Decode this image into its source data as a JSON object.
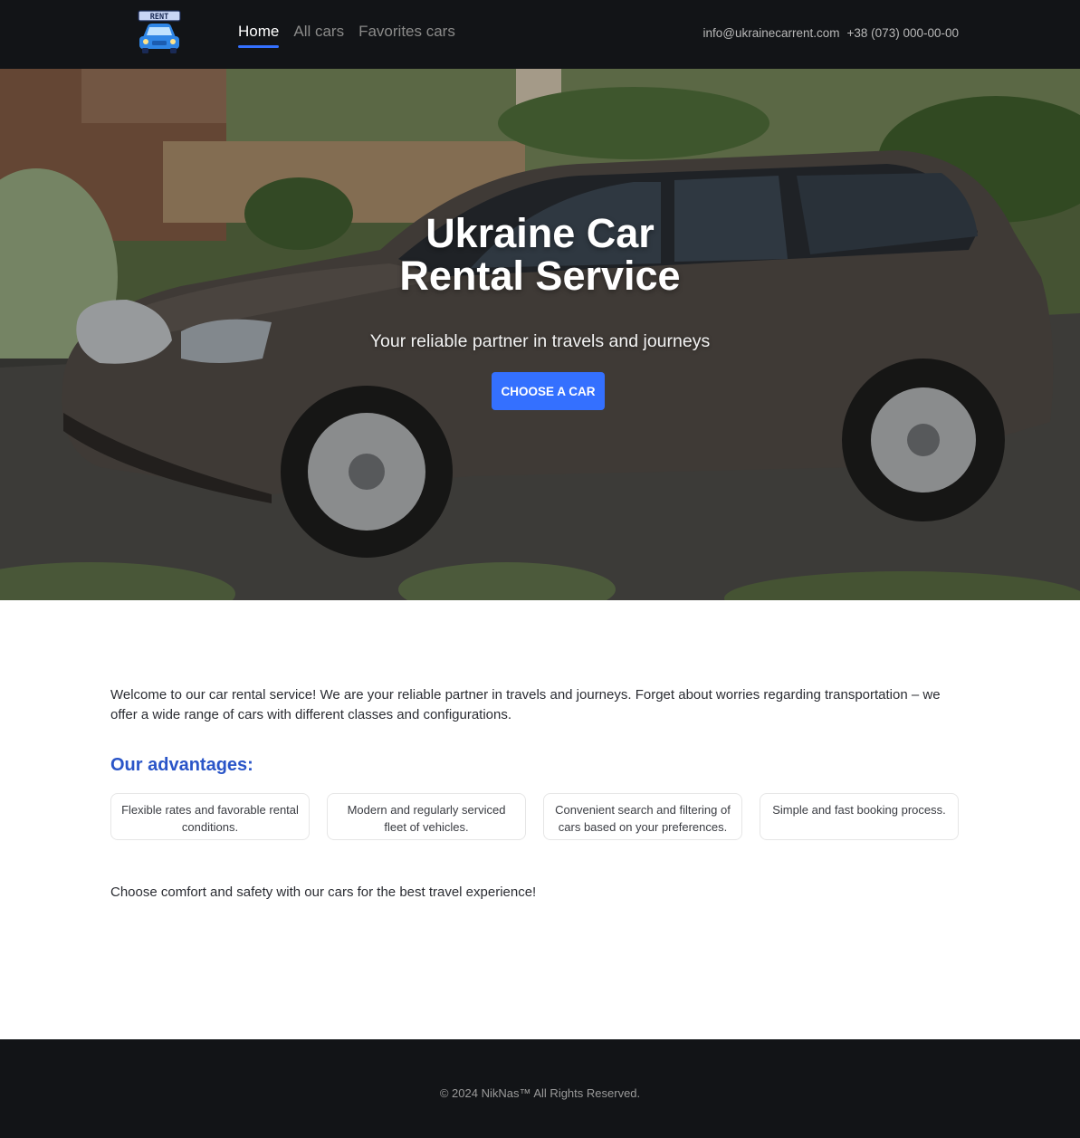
{
  "header": {
    "logo_text": "RENT",
    "nav": [
      {
        "label": "Home",
        "active": true
      },
      {
        "label": "All cars",
        "active": false
      },
      {
        "label": "Favorites cars",
        "active": false
      }
    ],
    "email": "info@ukrainecarrent.com",
    "phone": "+38 (073) 000-00-00"
  },
  "hero": {
    "title_line1": "Ukraine Car",
    "title_line2": "Rental Service",
    "subtitle": "Your reliable partner in travels and journeys",
    "cta_label": "CHOOSE A CAR"
  },
  "main": {
    "intro": "Welcome to our car rental service! We are your reliable partner in travels and journeys. Forget about worries regarding transportation – we offer a wide range of cars with different classes and configurations.",
    "advantages_title": "Our advantages:",
    "advantages": [
      "Flexible rates and favorable rental conditions.",
      "Modern and regularly serviced fleet of vehicles.",
      "Convenient search and filtering of cars based on your preferences.",
      "Simple and fast booking process."
    ],
    "closing": "Choose comfort and safety with our cars for the best travel experience!"
  },
  "footer": {
    "copyright": "© 2024 NikNas™ All Rights Reserved."
  },
  "colors": {
    "accent": "#3470ff",
    "header_bg": "#121417",
    "heading_blue": "#2a55c8"
  }
}
